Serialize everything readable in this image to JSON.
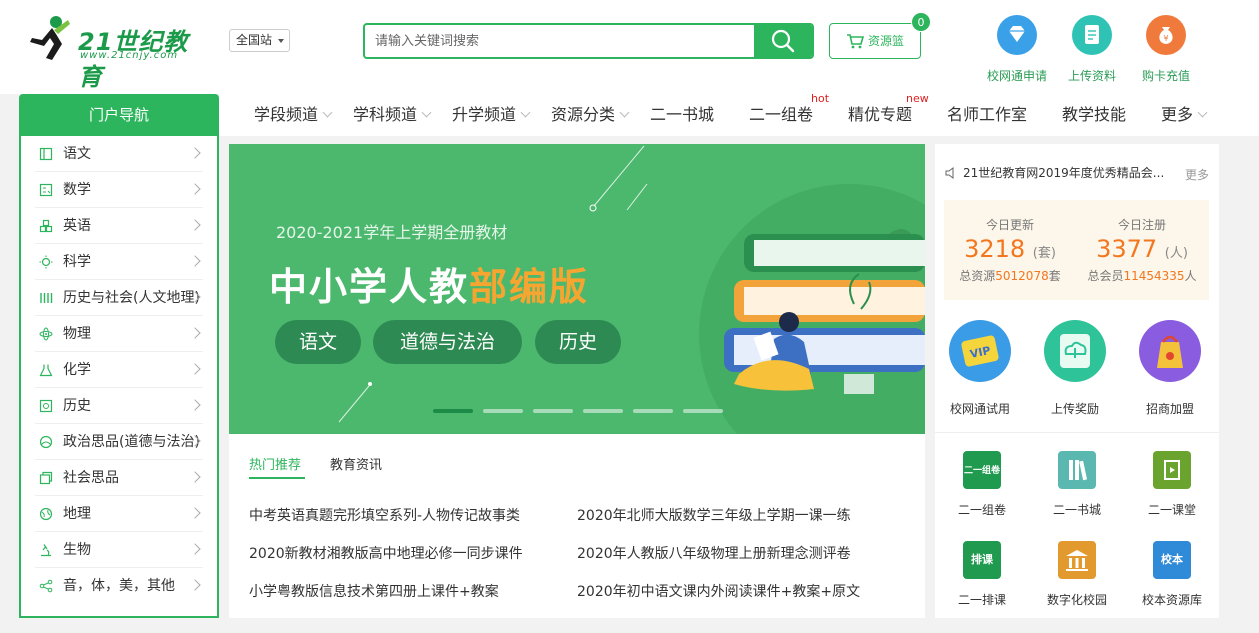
{
  "header": {
    "logo_main": "21世纪教育",
    "logo_sub": "www.21cnjy.com",
    "site_select": "全国站",
    "search_placeholder": "请输入关键词搜索",
    "basket_label": "资源篮",
    "basket_count": "0",
    "quick_links": [
      {
        "label": "校网通申请",
        "icon": "diamond-icon",
        "color": "#3aa0e8"
      },
      {
        "label": "上传资料",
        "icon": "document-icon",
        "color": "#2fc3b5"
      },
      {
        "label": "购卡充值",
        "icon": "money-bag-icon",
        "color": "#f07a3c"
      }
    ]
  },
  "nav": {
    "portal_title": "门户导航",
    "items": [
      {
        "label": "学段频道",
        "dropdown": true
      },
      {
        "label": "学科频道",
        "dropdown": true
      },
      {
        "label": "升学频道",
        "dropdown": true
      },
      {
        "label": "资源分类",
        "dropdown": true
      },
      {
        "label": "二一书城",
        "dropdown": false
      },
      {
        "label": "二一组卷",
        "dropdown": false,
        "tag": "hot"
      },
      {
        "label": "精优专题",
        "dropdown": false,
        "tag": "new"
      },
      {
        "label": "名师工作室",
        "dropdown": false
      },
      {
        "label": "教学技能",
        "dropdown": false
      },
      {
        "label": "更多",
        "dropdown": true
      }
    ]
  },
  "sidebar": {
    "items": [
      {
        "label": "语文",
        "icon": "book-icon"
      },
      {
        "label": "数学",
        "icon": "calculator-icon"
      },
      {
        "label": "英语",
        "icon": "blocks-icon"
      },
      {
        "label": "科学",
        "icon": "bulb-icon"
      },
      {
        "label": "历史与社会(人文地理)",
        "icon": "columns-icon"
      },
      {
        "label": "物理",
        "icon": "atom-icon"
      },
      {
        "label": "化学",
        "icon": "flask-icon"
      },
      {
        "label": "历史",
        "icon": "scroll-icon"
      },
      {
        "label": "政治思品(道德与法治)",
        "icon": "globe-icon"
      },
      {
        "label": "社会思品",
        "icon": "cards-icon"
      },
      {
        "label": "地理",
        "icon": "earth-icon"
      },
      {
        "label": "生物",
        "icon": "microscope-icon"
      },
      {
        "label": "音，体，美，其他",
        "icon": "share-icon"
      }
    ]
  },
  "banner": {
    "subtitle": "2020-2021学年上学期全册教材",
    "title_main": "中小学人教",
    "title_highlight": "部编版",
    "pills": [
      "语文",
      "道德与法治",
      "历史"
    ],
    "slides": 6,
    "active_slide": 1
  },
  "news": {
    "tabs": [
      "热门推荐",
      "教育资讯"
    ],
    "active_tab": 0,
    "links": [
      "中考英语真题完形填空系列-人物传记故事类",
      "2020年北师大版数学三年级上学期一课一练",
      "2020新教材湘教版高中地理必修一同步课件",
      "2020年人教版八年级物理上册新理念测评卷",
      "小学粤教版信息技术第四册上课件+教案",
      "2020年初中语文课内外阅读课件+教案+原文"
    ]
  },
  "right": {
    "notice": "21世纪教育网2019年度优秀精品会...",
    "more": "更多",
    "stats": [
      {
        "label": "今日更新",
        "value": "3218",
        "unit": "(套)",
        "total_label": "总资源",
        "total_value": "5012078",
        "total_unit": "套"
      },
      {
        "label": "今日注册",
        "value": "3377",
        "unit": "(人)",
        "total_label": "总会员",
        "total_value": "11454335",
        "total_unit": "人"
      }
    ],
    "big_tiles": [
      {
        "label": "校网通试用",
        "icon": "vip-icon",
        "color": "#3a9be6"
      },
      {
        "label": "上传奖励",
        "icon": "cloud-upload-icon",
        "color": "#2fc39a"
      },
      {
        "label": "招商加盟",
        "icon": "gift-bag-icon",
        "color": "#8a5ce0"
      }
    ],
    "small_tiles": [
      {
        "label": "二一组卷",
        "icon_text": "二一组卷",
        "color": "#1f9a4f"
      },
      {
        "label": "二一书城",
        "icon_text": "",
        "color": "#5bb8b0"
      },
      {
        "label": "二一课堂",
        "icon_text": "",
        "color": "#6aa32e"
      },
      {
        "label": "二一排课",
        "icon_text": "排课",
        "color": "#1f9a4f"
      },
      {
        "label": "数字化校园",
        "icon_text": "",
        "color": "#e29a2e"
      },
      {
        "label": "校本资源库",
        "icon_text": "校本",
        "color": "#2f8ad8"
      }
    ]
  }
}
